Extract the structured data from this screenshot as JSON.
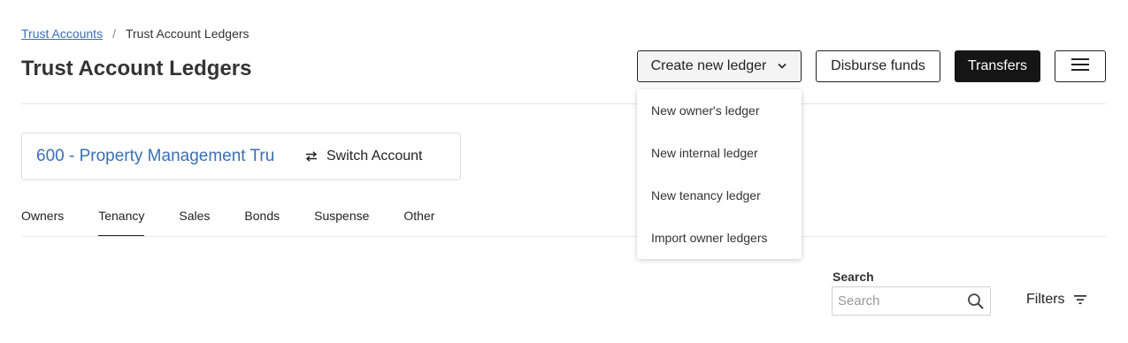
{
  "breadcrumb": {
    "parent": "Trust Accounts",
    "separator": "/",
    "current": "Trust Account Ledgers"
  },
  "page_title": "Trust Account Ledgers",
  "header_actions": {
    "create_label": "Create new ledger",
    "disburse_label": "Disburse funds",
    "transfers_label": "Transfers",
    "menu_icon": "hamburger-icon"
  },
  "create_menu": {
    "items": [
      {
        "label": "New owner's ledger"
      },
      {
        "label": "New internal ledger"
      },
      {
        "label": "New tenancy ledger"
      },
      {
        "label": "Import owner ledgers"
      }
    ]
  },
  "account": {
    "name": "600 - Property Management Tru",
    "switch_label": "Switch Account",
    "switch_icon": "swap-arrows-icon"
  },
  "tabs": [
    {
      "label": "Owners",
      "active": false
    },
    {
      "label": "Tenancy",
      "active": true
    },
    {
      "label": "Sales",
      "active": false
    },
    {
      "label": "Bonds",
      "active": false
    },
    {
      "label": "Suspense",
      "active": false
    },
    {
      "label": "Other",
      "active": false
    }
  ],
  "search": {
    "label": "Search",
    "placeholder": "Search",
    "value": ""
  },
  "filters": {
    "label": "Filters",
    "icon": "filter-lines-icon"
  },
  "colors": {
    "link": "#3a6fb5",
    "primary_button": "#151515",
    "border": "#222222"
  }
}
